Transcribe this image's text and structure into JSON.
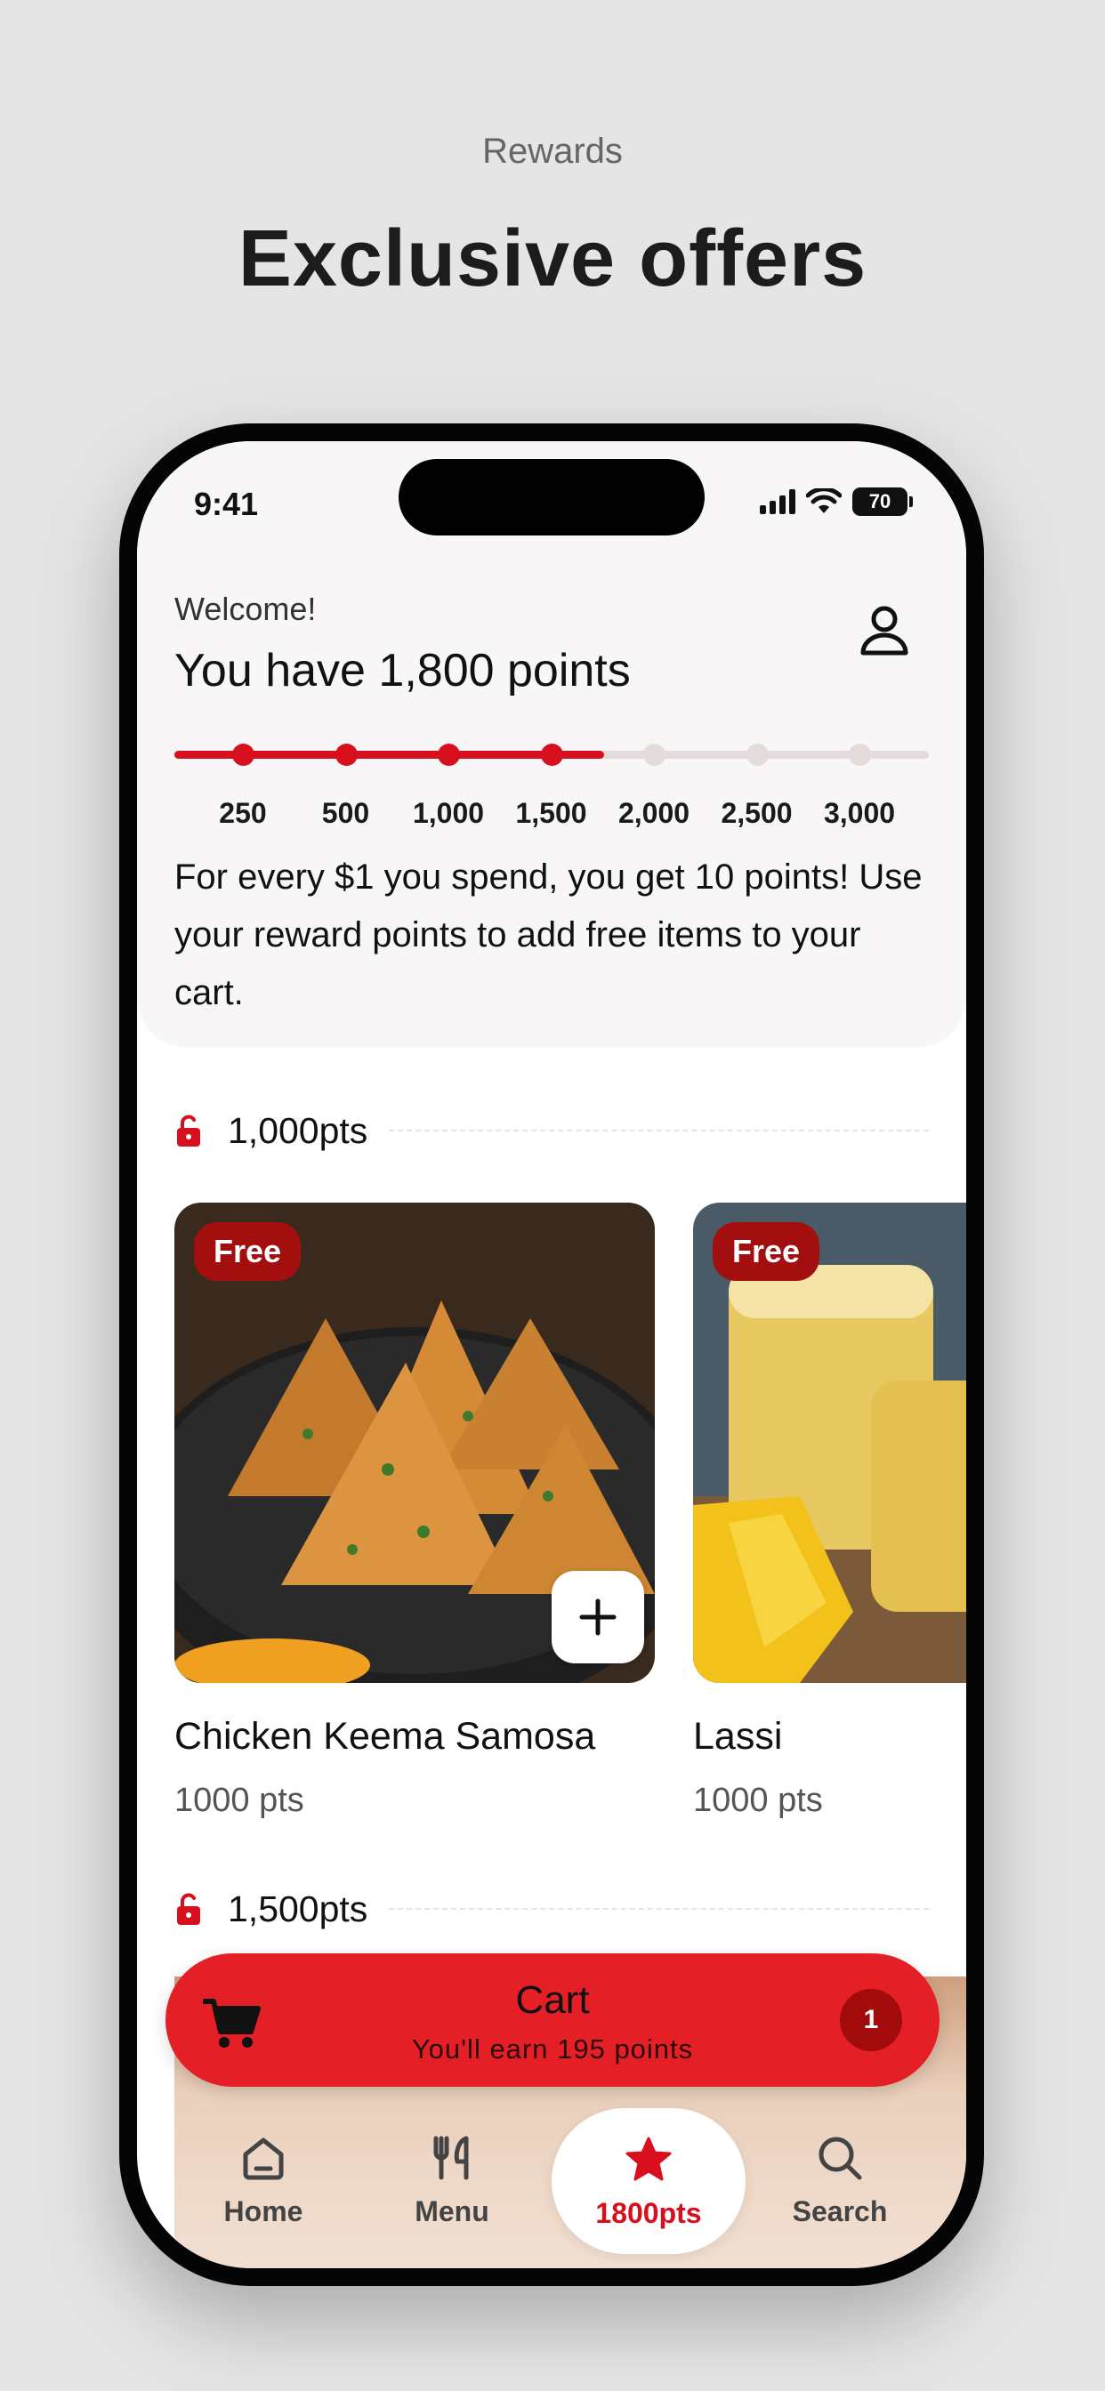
{
  "page": {
    "caption": "Rewards",
    "headline": "Exclusive offers"
  },
  "status_bar": {
    "time": "9:41",
    "battery": "70",
    "icons": [
      "cellular-signal-icon",
      "wifi-icon",
      "battery-icon"
    ]
  },
  "header": {
    "welcome": "Welcome!",
    "points_title": "You have 1,800 points",
    "profile_icon": "person-icon"
  },
  "rewards_progress": {
    "current_points": 1800,
    "max_points": 3000,
    "milestones": [
      "250",
      "500",
      "1,000",
      "1,500",
      "2,000",
      "2,500",
      "3,000"
    ],
    "milestones_reached": 4,
    "fill_fraction": 0.57
  },
  "info": {
    "text": "For every $1 you spend, you get 10 points! Use your reward points to add free items to your cart."
  },
  "sections": [
    {
      "label": "1,000pts",
      "icon": "unlock-icon",
      "items": [
        {
          "badge": "Free",
          "name": "Chicken Keema Samosa",
          "points": "1000 pts",
          "add_icon": "plus-icon"
        },
        {
          "badge": "Free",
          "name": "Lassi",
          "points": "1000 pts"
        }
      ]
    },
    {
      "label": "1,500pts",
      "icon": "unlock-icon"
    }
  ],
  "cart": {
    "title": "Cart",
    "subtitle": "You'll earn 195 points",
    "count": "1",
    "icon": "cart-icon"
  },
  "tabbar": {
    "tabs": [
      {
        "label": "Home",
        "icon": "home-icon"
      },
      {
        "label": "Menu",
        "icon": "utensils-icon"
      },
      {
        "label": "1800pts",
        "icon": "star-icon",
        "active": true
      },
      {
        "label": "Search",
        "icon": "search-icon"
      }
    ]
  },
  "colors": {
    "accent": "#d80f1c",
    "cart_bar": "#e51f26",
    "badge": "#a30e0e",
    "track": "#e3dcda"
  }
}
